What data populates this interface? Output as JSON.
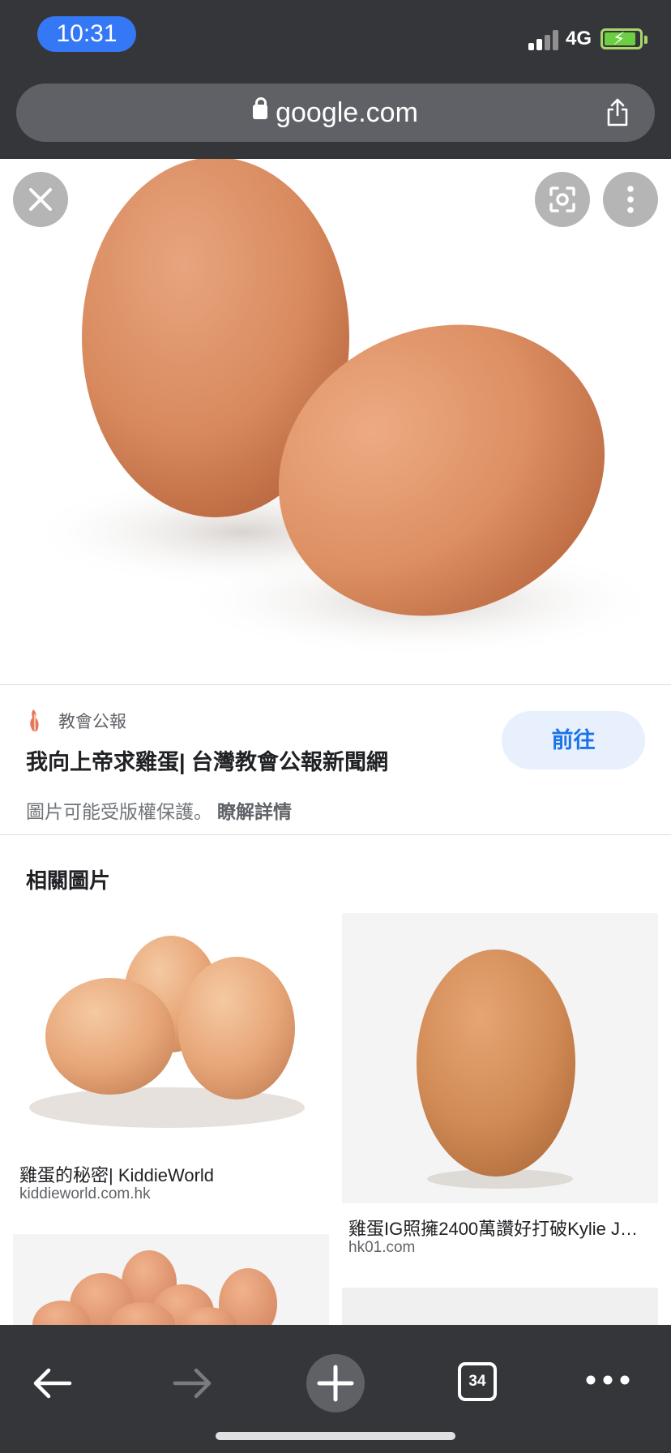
{
  "status_bar": {
    "time": "10:31",
    "network": "4G",
    "battery_state": "charging"
  },
  "browser": {
    "url": "google.com",
    "lock_icon": "lock-icon",
    "share_icon": "share-icon"
  },
  "viewer": {
    "close_icon": "close-icon",
    "lens_icon": "google-lens-icon",
    "more_icon": "more-vertical-icon"
  },
  "result": {
    "source_name": "教會公報",
    "title": "我向上帝求雞蛋| 台灣教會公報新聞網",
    "visit_label": "前往",
    "copyright_text": "圖片可能受版權保護。",
    "learn_more": "瞭解詳情"
  },
  "related": {
    "heading": "相關圖片",
    "items": [
      {
        "title": "雞蛋的秘密| KiddieWorld",
        "domain": "kiddieworld.com.hk"
      },
      {
        "title": "雞蛋IG照擁2400萬讚好打破Kylie J…",
        "domain": "hk01.com"
      }
    ]
  },
  "toolbar": {
    "tab_count": "34",
    "icons": [
      "back-arrow-icon",
      "forward-arrow-icon",
      "new-tab-plus-icon",
      "tab-switcher-icon",
      "more-horizontal-icon"
    ]
  },
  "colors": {
    "chrome_dark": "#35363a",
    "time_pill": "#3478f6",
    "accent_blue": "#1a73e8",
    "visit_bg": "#e8f0fe"
  }
}
